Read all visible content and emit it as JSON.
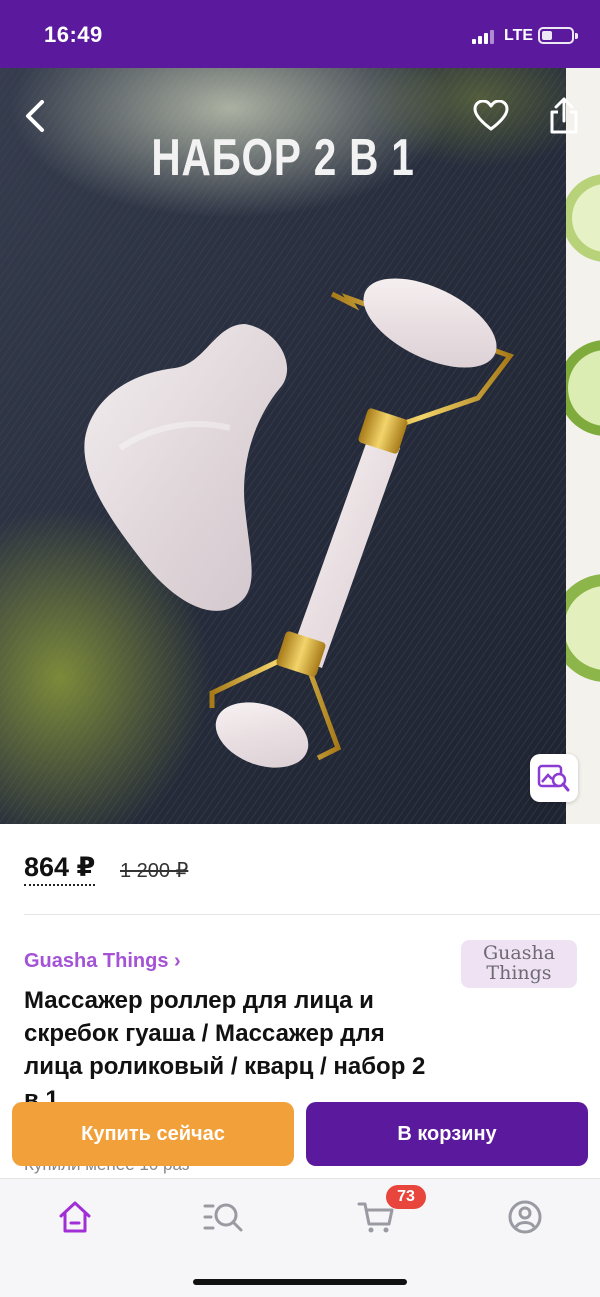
{
  "status_bar": {
    "time": "16:49",
    "network": "LTE"
  },
  "gallery": {
    "promo_text": "НАБОР 2 В 1",
    "back_icon": "chevron-left-icon",
    "favorite_icon": "heart-icon",
    "share_icon": "share-icon",
    "visual_search_icon": "image-search-icon"
  },
  "price": {
    "current": "864 ₽",
    "old": "1 200 ₽"
  },
  "seller": {
    "name": "Guasha Things ›",
    "logo_line1": "Guasha",
    "logo_line2": "Things"
  },
  "product": {
    "title": "Массажер роллер для лица и скребок гуаша / Массажер для лица роликовый / кварц / набор 2 в 1",
    "purchased": "Купили менее 10 раз"
  },
  "actions": {
    "buy_now": "Купить сейчас",
    "add_to_cart": "В корзину"
  },
  "tab_bar": {
    "items": [
      "home-icon",
      "catalog-search-icon",
      "cart-icon",
      "profile-icon"
    ],
    "cart_count": "73"
  },
  "colors": {
    "brand": "#5b1a9e",
    "buy_now": "#f2a03a",
    "seller_link": "#a453d6",
    "badge": "#e8453c"
  }
}
